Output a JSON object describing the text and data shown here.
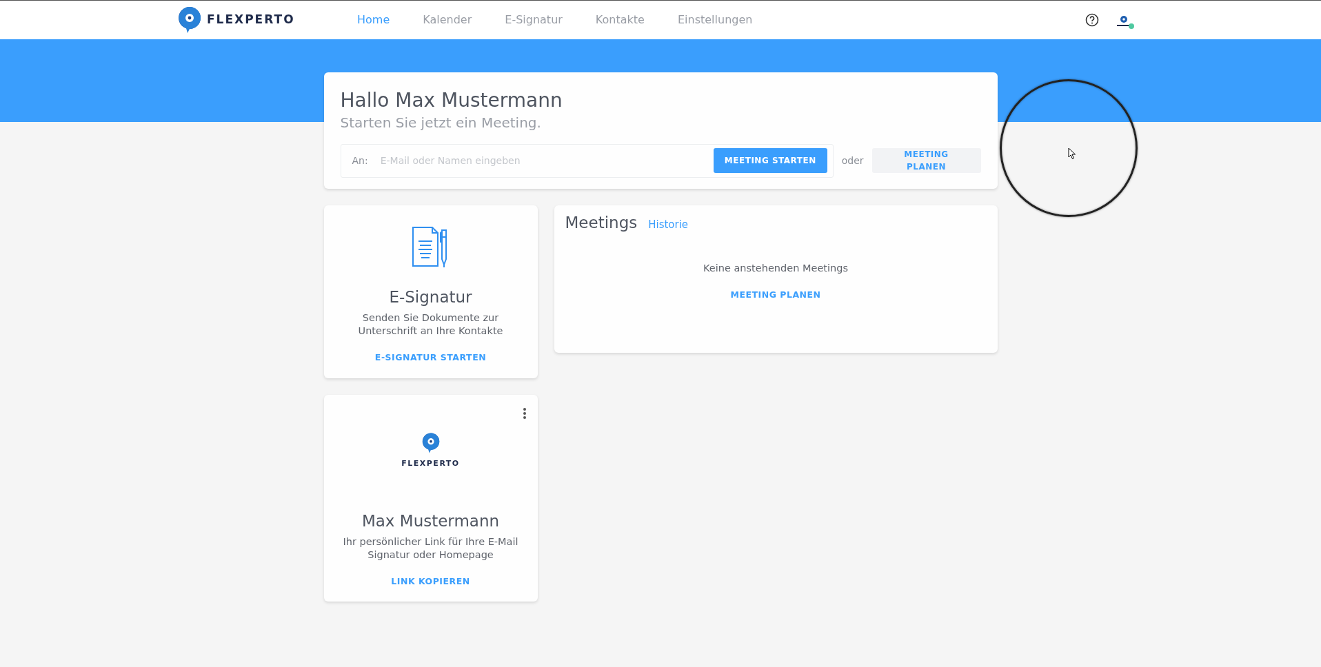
{
  "navbar": {
    "logo_text": "FLEXPERTO",
    "items": [
      {
        "label": "Home",
        "selected": true
      },
      {
        "label": "Kalender",
        "selected": false
      },
      {
        "label": "E-Signatur",
        "selected": false
      },
      {
        "label": "Kontakte",
        "selected": false
      },
      {
        "label": "Einstellungen",
        "selected": false
      }
    ],
    "user": {
      "online": true
    }
  },
  "greeting": {
    "title": "Hallo Max Mustermann",
    "subtitle": "Starten Sie jetzt ein Meeting.",
    "to_label": "An:",
    "placeholder": "E-Mail oder Namen eingeben",
    "start_button": "MEETING STARTEN",
    "or_text": "oder",
    "plan_button": "MEETING PLANEN"
  },
  "esign_card": {
    "title": "E-Signatur",
    "text": "Senden Sie Dokumente zur Unterschrift an Ihre Kontakte",
    "action": "E-SIGNATUR STARTEN"
  },
  "meetings_card": {
    "title": "Meetings",
    "history_link": "Historie",
    "empty_text": "Keine anstehenden Meetings",
    "action": "MEETING PLANEN"
  },
  "link_card": {
    "logo_text": "FLEXPERTO",
    "name": "Max Mustermann",
    "text": "Ihr persönlicher Link für Ihre E-Mail Signatur oder Homepage",
    "action": "LINK KOPIEREN"
  }
}
